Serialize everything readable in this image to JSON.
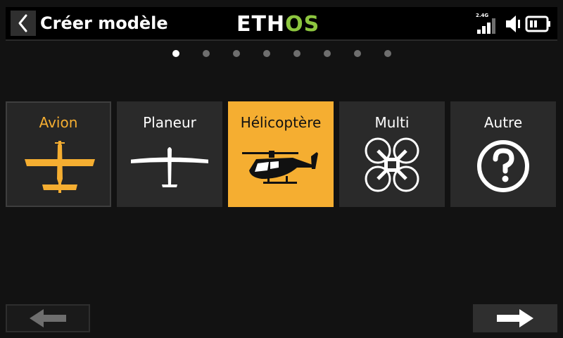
{
  "header": {
    "title": "Créer modèle",
    "logo_left": "ETH",
    "logo_right": "OS",
    "signal_label": "2.4G"
  },
  "pagination": {
    "total": 8,
    "current": 1
  },
  "model_types": [
    {
      "label": "Avion",
      "icon": "airplane-icon",
      "state": "focused"
    },
    {
      "label": "Planeur",
      "icon": "glider-icon",
      "state": "normal"
    },
    {
      "label": "Hélicoptère",
      "icon": "helicopter-icon",
      "state": "selected"
    },
    {
      "label": "Multi",
      "icon": "quadcopter-icon",
      "state": "normal"
    },
    {
      "label": "Autre",
      "icon": "question-icon",
      "state": "normal"
    }
  ],
  "colors": {
    "accent": "#f5ae31",
    "logo_green": "#8dc63f",
    "tile_bg": "#2a2a2a",
    "background": "#121212"
  }
}
